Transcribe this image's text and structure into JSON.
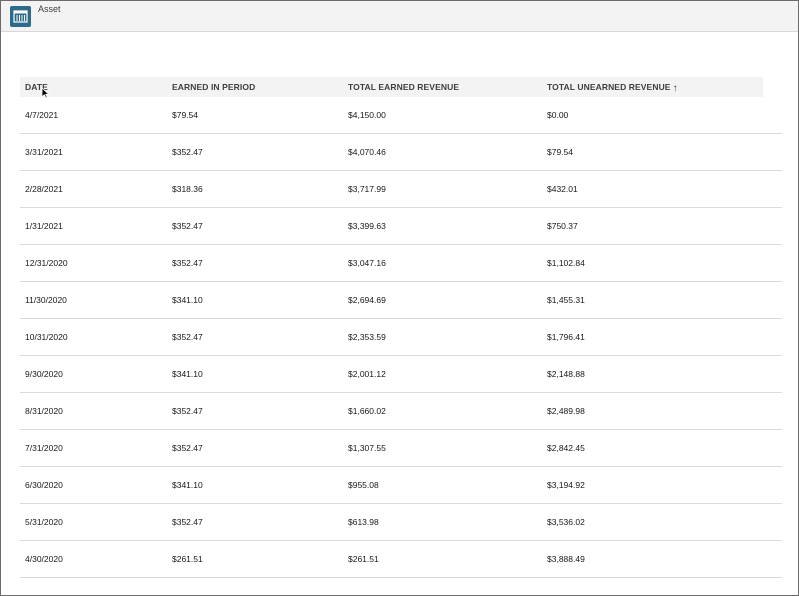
{
  "header": {
    "title": "Asset",
    "icon": "asset-icon",
    "accent": "#2d6b8a"
  },
  "table": {
    "columns": [
      {
        "label": "DATE"
      },
      {
        "label": "EARNED IN PERIOD"
      },
      {
        "label": "TOTAL EARNED REVENUE"
      },
      {
        "label": "TOTAL UNEARNED REVENUE",
        "sort": "ascending"
      }
    ],
    "rows": [
      [
        "4/7/2021",
        "$79.54",
        "$4,150.00",
        "$0.00"
      ],
      [
        "3/31/2021",
        "$352.47",
        "$4,070.46",
        "$79.54"
      ],
      [
        "2/28/2021",
        "$318.36",
        "$3,717.99",
        "$432.01"
      ],
      [
        "1/31/2021",
        "$352.47",
        "$3,399.63",
        "$750.37"
      ],
      [
        "12/31/2020",
        "$352.47",
        "$3,047.16",
        "$1,102.84"
      ],
      [
        "11/30/2020",
        "$341.10",
        "$2,694.69",
        "$1,455.31"
      ],
      [
        "10/31/2020",
        "$352.47",
        "$2,353.59",
        "$1,796.41"
      ],
      [
        "9/30/2020",
        "$341.10",
        "$2,001.12",
        "$2,148.88"
      ],
      [
        "8/31/2020",
        "$352.47",
        "$1,660.02",
        "$2,489.98"
      ],
      [
        "7/31/2020",
        "$352.47",
        "$1,307.55",
        "$2,842.45"
      ],
      [
        "6/30/2020",
        "$341.10",
        "$955.08",
        "$3,194.92"
      ],
      [
        "5/31/2020",
        "$352.47",
        "$613.98",
        "$3,536.02"
      ],
      [
        "4/30/2020",
        "$261.51",
        "$261.51",
        "$3,888.49"
      ]
    ]
  }
}
